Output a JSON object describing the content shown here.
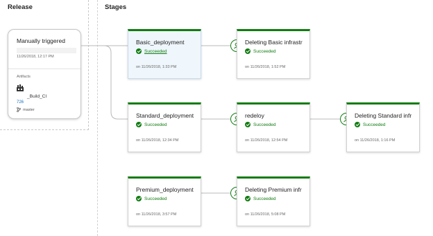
{
  "release": {
    "section_title": "Release",
    "trigger": "Manually triggered",
    "time": "11/26/2018, 12:17 PM",
    "artifacts_label": "Artifacts",
    "artifact_name": "_Build_CI",
    "build_number": "726",
    "branch": "master"
  },
  "stages_title": "Stages",
  "stages": {
    "basic": {
      "name": "Basic_deployment",
      "status": "Succeeded",
      "time": "on 11/26/2018, 1:33 PM"
    },
    "deleting_basic": {
      "name": "Deleting Basic infrastr",
      "status": "Succeeded",
      "time": "on 11/26/2018, 1:52 PM"
    },
    "standard": {
      "name": "Standard_deployment",
      "status": "Succeeded",
      "time": "on 11/26/2018, 12:34 PM"
    },
    "redeloy": {
      "name": "redeloy",
      "status": "Succeeded",
      "time": "on 11/26/2018, 12:54 PM"
    },
    "deleting_standard": {
      "name": "Deleting Standard infr",
      "status": "Succeeded",
      "time": "on 11/26/2018, 1:16 PM"
    },
    "premium": {
      "name": "Premium_deployment",
      "status": "Succeeded",
      "time": "on 11/26/2018, 3:57 PM"
    },
    "deleting_premium": {
      "name": "Deleting Premium infr",
      "status": "Succeeded",
      "time": "on 11/26/2018, 5:08 PM"
    }
  },
  "colors": {
    "success": "#107c10",
    "link": "#106ebe",
    "selected_bg": "#eff6fc"
  },
  "icons": [
    "check-circle-icon",
    "approver-person-icon",
    "build-artifact-icon",
    "branch-icon"
  ]
}
